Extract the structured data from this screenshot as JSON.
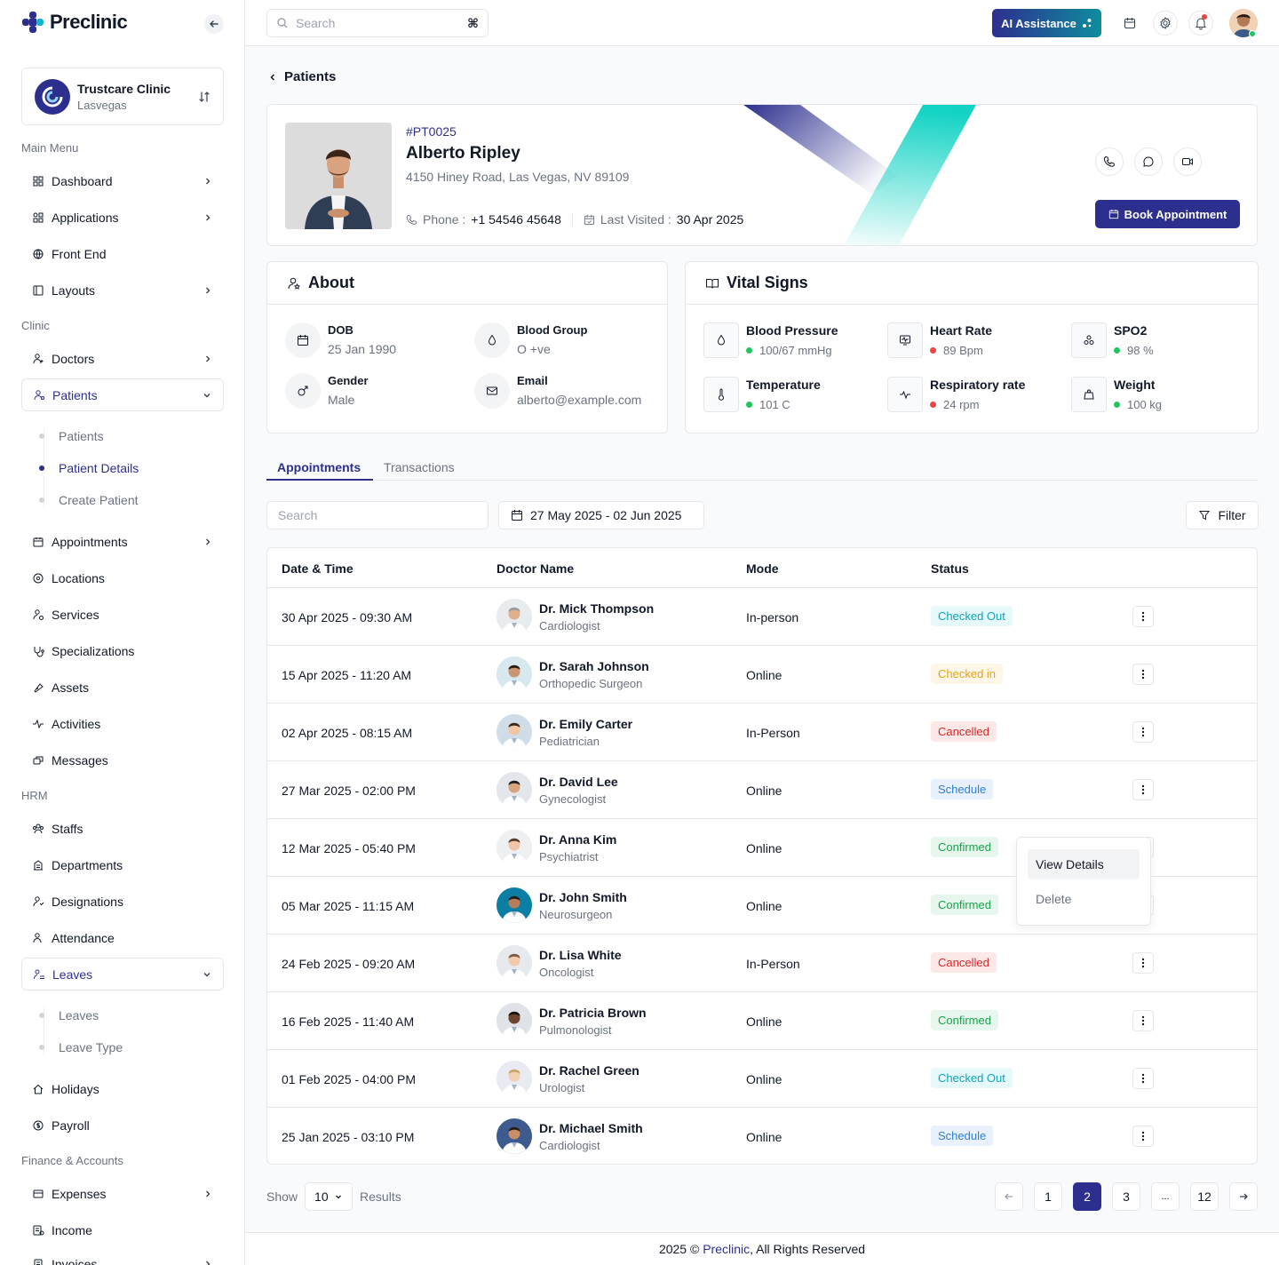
{
  "brand": {
    "name": "Preclinic"
  },
  "clinic": {
    "name": "Trustcare Clinic",
    "city": "Lasvegas"
  },
  "sidebar": {
    "headings": {
      "main": "Main Menu",
      "clinic": "Clinic",
      "hrm": "HRM",
      "finance": "Finance & Accounts"
    },
    "items": {
      "dashboard": "Dashboard",
      "applications": "Applications",
      "frontend": "Front End",
      "layouts": "Layouts",
      "doctors": "Doctors",
      "patients": "Patients",
      "appointments": "Appointments",
      "locations": "Locations",
      "services": "Services",
      "specializations": "Specializations",
      "assets": "Assets",
      "activities": "Activities",
      "messages": "Messages",
      "staffs": "Staffs",
      "departments": "Departments",
      "designations": "Designations",
      "attendance": "Attendance",
      "leaves": "Leaves",
      "holidays": "Holidays",
      "payroll": "Payroll",
      "expenses": "Expenses",
      "income": "Income",
      "invoices": "Invoices"
    },
    "patients_sub": [
      "Patients",
      "Patient Details",
      "Create Patient"
    ],
    "leaves_sub": [
      "Leaves",
      "Leave Type"
    ]
  },
  "topbar": {
    "search_placeholder": "Search",
    "shortcut": "⌘",
    "ai_label": "AI Assistance"
  },
  "breadcrumb": "Patients",
  "patient": {
    "id": "#PT0025",
    "name": "Alberto Ripley",
    "address": "4150 Hiney Road, Las Vegas, NV 89109",
    "phone_label": "Phone :",
    "phone": "+1 54546 45648",
    "last_visited_label": "Last Visited :",
    "last_visited": "30 Apr 2025",
    "book_label": "Book Appointment"
  },
  "about": {
    "title": "About",
    "dob_label": "DOB",
    "dob": "25 Jan 1990",
    "blood_label": "Blood Group",
    "blood": "O +ve",
    "gender_label": "Gender",
    "gender": "Male",
    "email_label": "Email",
    "email": "alberto@example.com"
  },
  "vitals": {
    "title": "Vital Signs",
    "items": [
      {
        "label": "Blood Pressure",
        "value": "100/67 mmHg",
        "status_color": "#22c55e"
      },
      {
        "label": "Heart Rate",
        "value": "89 Bpm",
        "status_color": "#ef4444"
      },
      {
        "label": "SPO2",
        "value": "98 %",
        "status_color": "#22c55e"
      },
      {
        "label": "Temperature",
        "value": "101 C",
        "status_color": "#22c55e"
      },
      {
        "label": "Respiratory rate",
        "value": "24 rpm",
        "status_color": "#ef4444"
      },
      {
        "label": "Weight",
        "value": "100 kg",
        "status_color": "#22c55e"
      }
    ]
  },
  "tabs": [
    "Appointments",
    "Transactions"
  ],
  "filters": {
    "search_placeholder": "Search",
    "date_range": "27 May 2025 - 02 Jun 2025",
    "filter_label": "Filter"
  },
  "table": {
    "headers": [
      "Date & Time",
      "Doctor Name",
      "Mode",
      "Status"
    ],
    "rows": [
      {
        "datetime": "30 Apr 2025 - 09:30 AM",
        "doctor": "Dr. Mick Thompson",
        "specialty": "Cardiologist",
        "mode": "In-person",
        "status": "Checked Out"
      },
      {
        "datetime": "15 Apr 2025 - 11:20 AM",
        "doctor": "Dr. Sarah Johnson",
        "specialty": "Orthopedic Surgeon",
        "mode": "Online",
        "status": "Checked in"
      },
      {
        "datetime": "02 Apr 2025 - 08:15 AM",
        "doctor": "Dr. Emily Carter",
        "specialty": "Pediatrician",
        "mode": "In-Person",
        "status": "Cancelled"
      },
      {
        "datetime": "27 Mar 2025 - 02:00 PM",
        "doctor": "Dr. David Lee",
        "specialty": "Gynecologist",
        "mode": "Online",
        "status": "Schedule"
      },
      {
        "datetime": "12 Mar 2025 - 05:40 PM",
        "doctor": "Dr. Anna Kim",
        "specialty": "Psychiatrist",
        "mode": "Online",
        "status": "Confirmed"
      },
      {
        "datetime": "05 Mar 2025 - 11:15 AM",
        "doctor": "Dr. John Smith",
        "specialty": "Neurosurgeon",
        "mode": "Online",
        "status": "Confirmed"
      },
      {
        "datetime": "24 Feb 2025 - 09:20 AM",
        "doctor": "Dr. Lisa White",
        "specialty": "Oncologist",
        "mode": "In-Person",
        "status": "Cancelled"
      },
      {
        "datetime": "16 Feb 2025 - 11:40 AM",
        "doctor": "Dr. Patricia Brown",
        "specialty": "Pulmonologist",
        "mode": "Online",
        "status": "Confirmed"
      },
      {
        "datetime": "01 Feb 2025 - 04:00 PM",
        "doctor": "Dr. Rachel Green",
        "specialty": "Urologist",
        "mode": "Online",
        "status": "Checked Out"
      },
      {
        "datetime": "25 Jan 2025 - 03:10 PM",
        "doctor": "Dr. Michael Smith",
        "specialty": "Cardiologist",
        "mode": "Online",
        "status": "Schedule"
      }
    ]
  },
  "status_colors": {
    "Checked Out": {
      "bg": "#e6f9fb",
      "fg": "#0ea5b7"
    },
    "Checked in": {
      "bg": "#fef6e7",
      "fg": "#e5a417"
    },
    "Cancelled": {
      "bg": "#fde8e8",
      "fg": "#dc2626"
    },
    "Schedule": {
      "bg": "#e8f1fd",
      "fg": "#2f7fd6"
    },
    "Confirmed": {
      "bg": "#e8f7ee",
      "fg": "#16a34a"
    }
  },
  "row_menu": {
    "view": "View Details",
    "delete": "Delete"
  },
  "pagination": {
    "show_label": "Show",
    "per_page": "10",
    "results_label": "Results",
    "pages": [
      "1",
      "2",
      "3",
      "...",
      "12"
    ],
    "current": "2"
  },
  "footer": {
    "year": "2025 ©",
    "brand": "Preclinic",
    "suffix": ", All Rights Reserved"
  }
}
